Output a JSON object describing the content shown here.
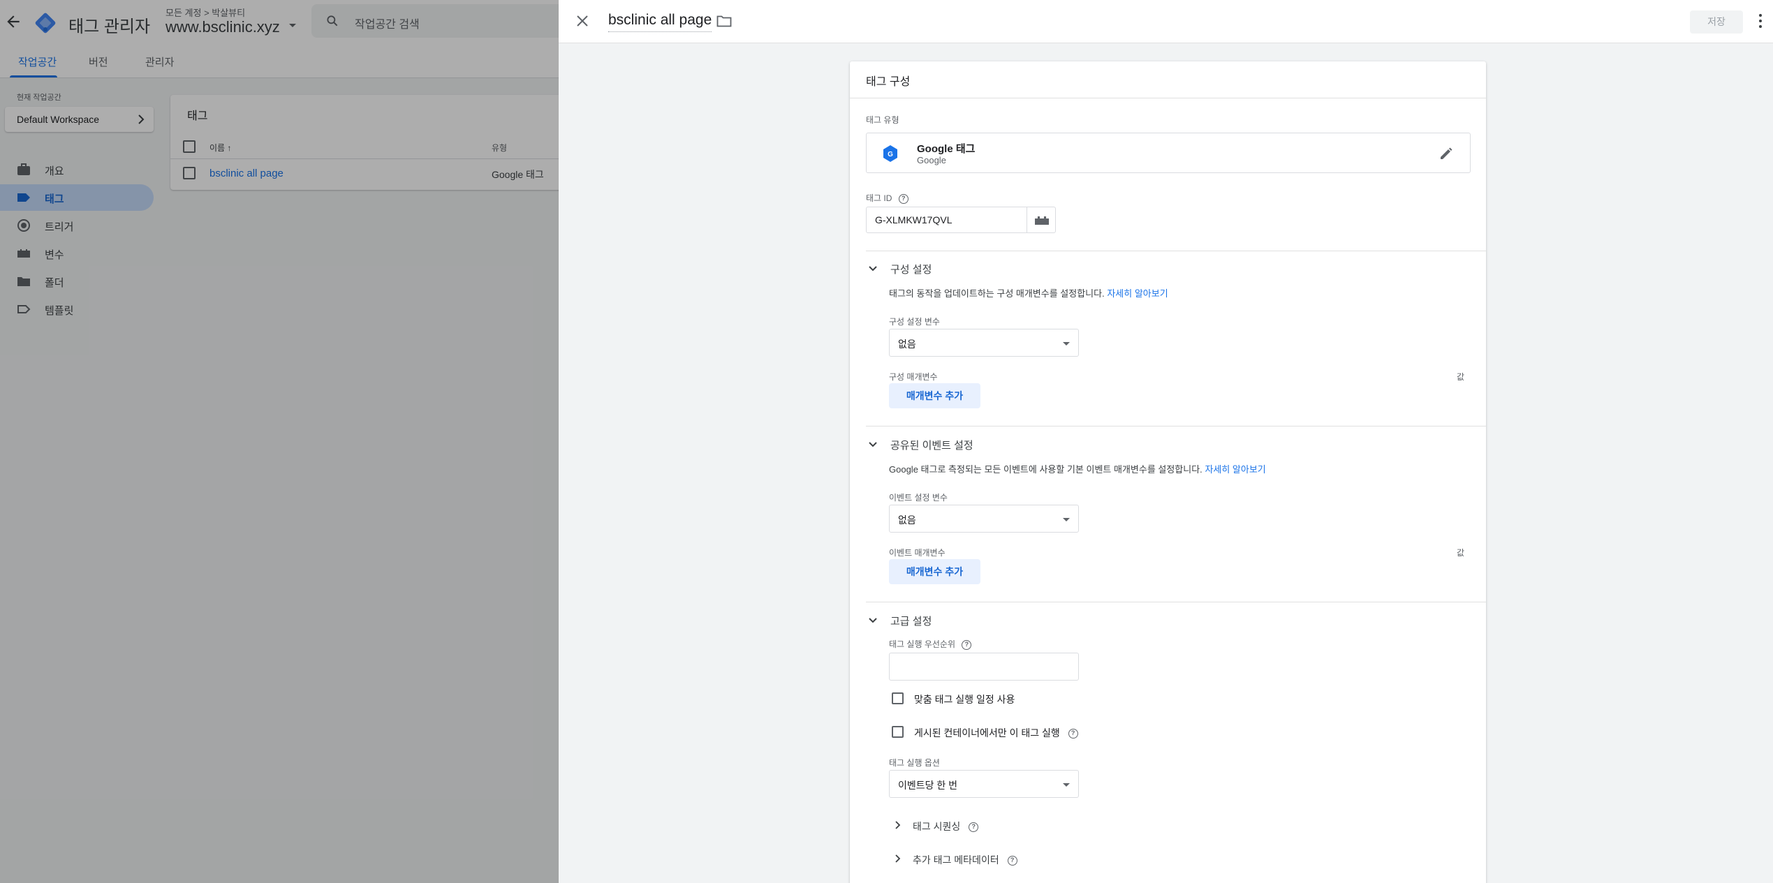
{
  "app": {
    "product_name": "태그 관리자",
    "account_path": "모든 계정 > 박살뷰티",
    "container_name": "www.bsclinic.xyz",
    "search_placeholder": "작업공간 검색",
    "tabs": [
      {
        "label": "작업공간",
        "active": true
      },
      {
        "label": "버전",
        "active": false
      },
      {
        "label": "관리자",
        "active": false
      }
    ],
    "workspace_label": "현재 작업공간",
    "workspace_name": "Default Workspace",
    "nav": [
      {
        "label": "개요",
        "icon": "briefcase-icon",
        "active": false
      },
      {
        "label": "태그",
        "icon": "tag-icon",
        "active": true
      },
      {
        "label": "트리거",
        "icon": "trigger-icon",
        "active": false
      },
      {
        "label": "변수",
        "icon": "variable-icon",
        "active": false
      },
      {
        "label": "폴더",
        "icon": "folder-icon",
        "active": false
      },
      {
        "label": "템플릿",
        "icon": "template-icon",
        "active": false
      }
    ],
    "tags_card": {
      "title": "태그",
      "col_name": "이름 ↑",
      "col_type": "유형",
      "rows": [
        {
          "name": "bsclinic all page",
          "type": "Google 태그"
        }
      ]
    }
  },
  "sheet": {
    "title": "bsclinic all page",
    "save_label": "저장",
    "card_title": "태그 구성",
    "tag_type_label": "태그 유형",
    "tag_type_name": "Google 태그",
    "tag_type_vendor": "Google",
    "tag_id_label": "태그 ID",
    "tag_id_value": "G-XLMKW17QVL",
    "config_section": {
      "title": "구성 설정",
      "desc": "태그의 동작을 업데이트하는 구성 매개변수를 설정합니다.",
      "link": "자세히 알아보기",
      "var_label": "구성 설정 변수",
      "var_value": "없음",
      "params_label": "구성 매개변수",
      "value_label": "값",
      "add_button": "매개변수 추가"
    },
    "event_section": {
      "title": "공유된 이벤트 설정",
      "desc": "Google 태그로 측정되는 모든 이벤트에 사용할 기본 이벤트 매개변수를 설정합니다.",
      "link": "자세히 알아보기",
      "var_label": "이벤트 설정 변수",
      "var_value": "없음",
      "params_label": "이벤트 매개변수",
      "value_label": "값",
      "add_button": "매개변수 추가"
    },
    "advanced_section": {
      "title": "고급 설정",
      "priority_label": "태그 실행 우선순위",
      "priority_value": "",
      "schedule_checkbox": "맞춤 태그 실행 일정 사용",
      "published_checkbox": "게시된 컨테이너에서만 이 태그 실행",
      "firing_label": "태그 실행 옵션",
      "firing_value": "이벤트당 한 번",
      "sequencing": "태그 시퀀싱",
      "metadata": "추가 태그 메타데이터"
    }
  }
}
